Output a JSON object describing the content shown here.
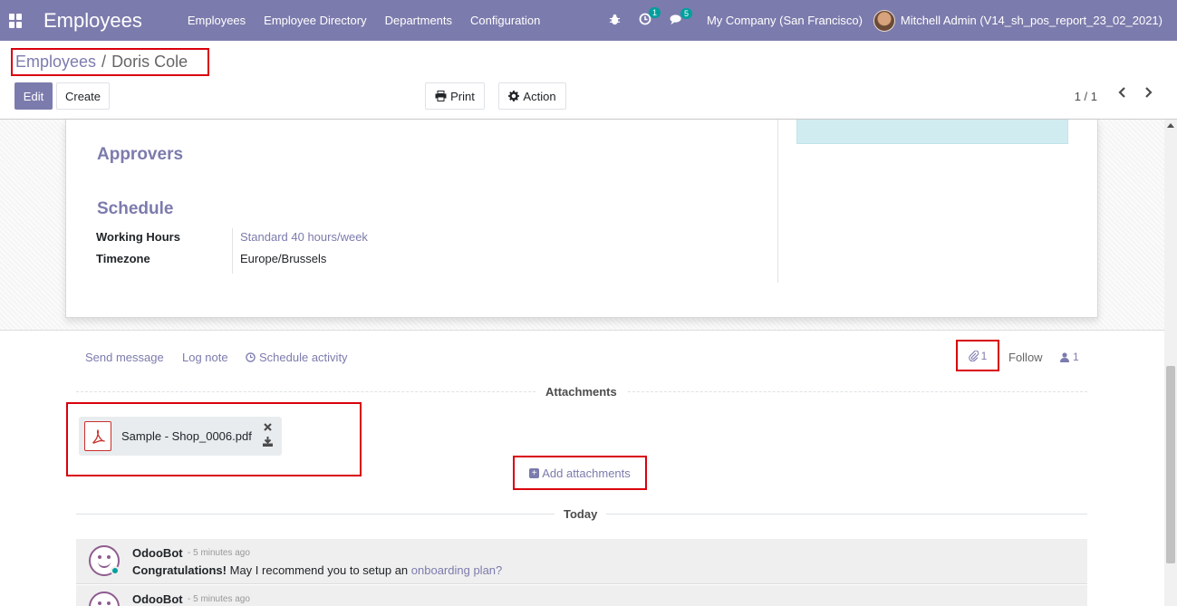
{
  "navbar": {
    "app_name": "Employees",
    "menu": [
      "Employees",
      "Employee Directory",
      "Departments",
      "Configuration"
    ],
    "activity_badge": "1",
    "messages_badge": "5",
    "company": "My Company (San Francisco)",
    "user": "Mitchell Admin (V14_sh_pos_report_23_02_2021)"
  },
  "control_panel": {
    "breadcrumb_parent": "Employees",
    "breadcrumb_sep": "/",
    "breadcrumb_current": "Doris Cole",
    "edit_label": "Edit",
    "create_label": "Create",
    "print_label": "Print",
    "action_label": "Action",
    "pager": "1 / 1"
  },
  "form": {
    "approvers_title": "Approvers",
    "schedule_title": "Schedule",
    "working_hours_label": "Working Hours",
    "working_hours_value": "Standard 40 hours/week",
    "timezone_label": "Timezone",
    "timezone_value": "Europe/Brussels"
  },
  "chatter": {
    "send_message": "Send message",
    "log_note": "Log note",
    "schedule_activity": "Schedule activity",
    "attachment_count": "1",
    "follow": "Follow",
    "follower_count": "1",
    "attachments_title": "Attachments",
    "attachment_name": "Sample - Shop_0006.pdf",
    "add_attachments": "Add attachments",
    "today_label": "Today",
    "messages": [
      {
        "author": "OdooBot",
        "date": "- 5 minutes ago",
        "body_bold": "Congratulations!",
        "body_text": " May I recommend you to setup an ",
        "body_link": "onboarding plan?"
      },
      {
        "author": "OdooBot",
        "date": "- 5 minutes ago"
      }
    ]
  },
  "colors": {
    "brand": "#7c7bad",
    "highlight": "#d9000d",
    "badge": "#00a09d"
  }
}
